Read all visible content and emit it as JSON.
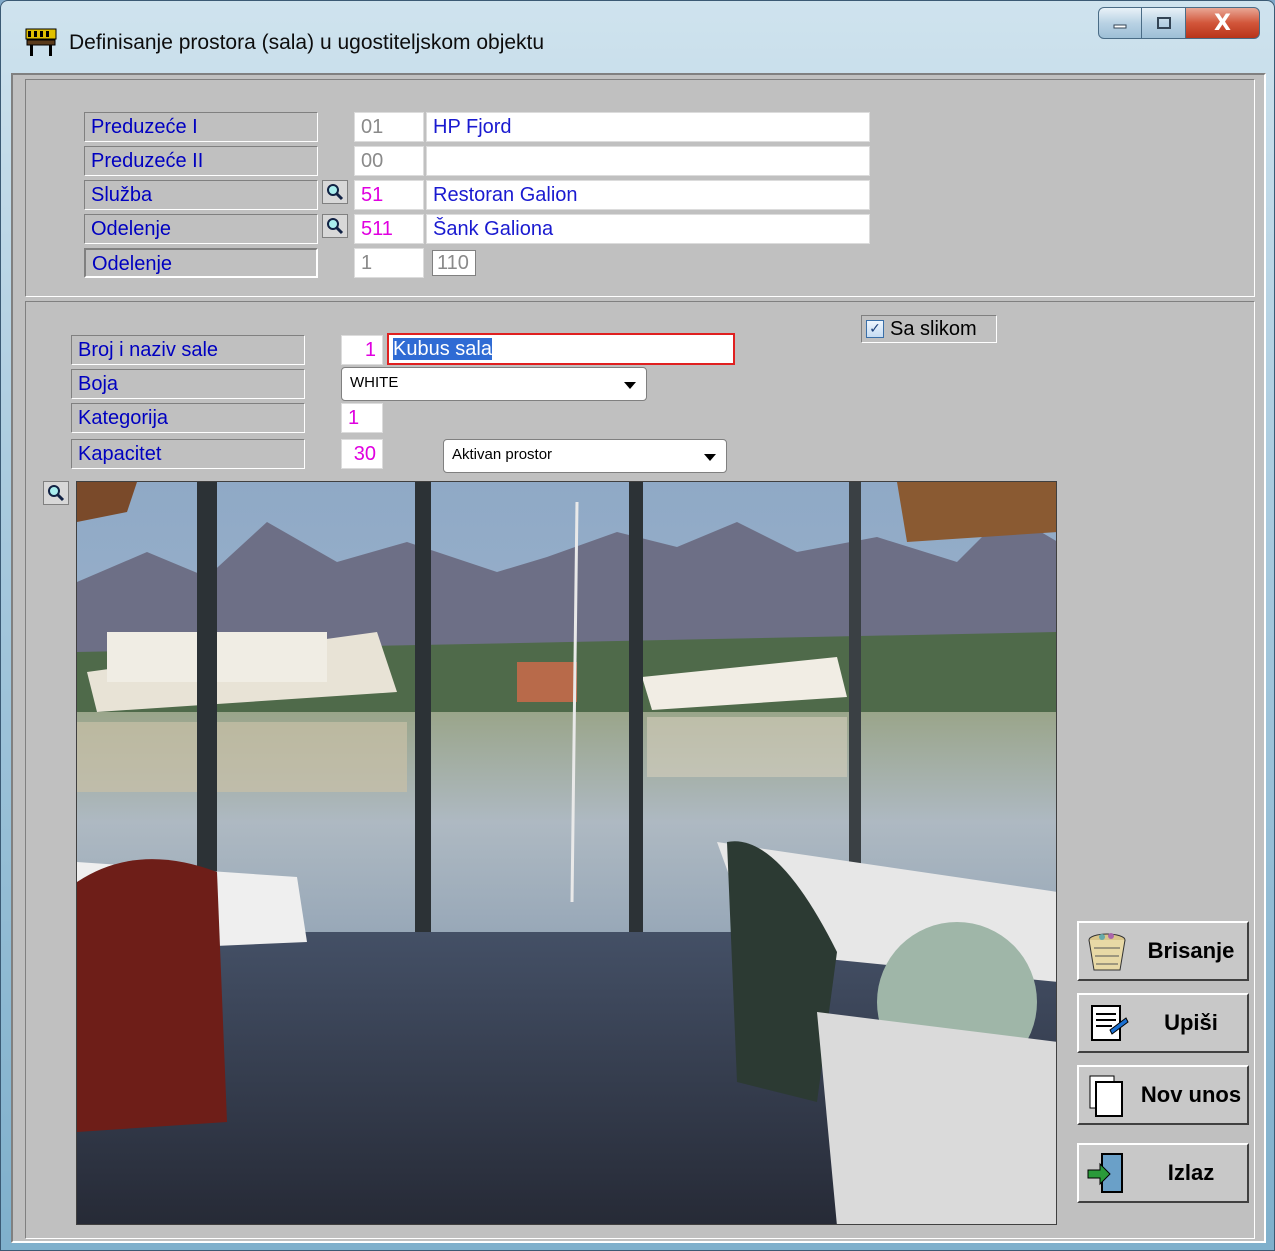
{
  "window": {
    "title": "Definisanje prostora (sala) u ugostiteljskom objektu",
    "close_glyph": "X"
  },
  "top_panel": {
    "rows": [
      {
        "label": "Preduzeće I",
        "code": "01",
        "name": "HP Fjord"
      },
      {
        "label": "Preduzeće II",
        "code": "00",
        "name": ""
      },
      {
        "label": "Služba",
        "code": "51",
        "name": "Restoran Galion"
      },
      {
        "label": "Odelenje",
        "code": "511",
        "name": "Šank Galiona"
      },
      {
        "label": "Odelenje",
        "code": "1",
        "extra": "110"
      }
    ]
  },
  "bottom_panel": {
    "sa_slikom": {
      "label": "Sa slikom",
      "checked": true,
      "check_glyph": "✓"
    },
    "broj_naziv": {
      "label": "Broj i naziv sale",
      "number": "1",
      "name": "Kubus sala"
    },
    "boja": {
      "label": "Boja",
      "value": "WHITE"
    },
    "kategorija": {
      "label": "Kategorija",
      "value": "1"
    },
    "kapacitet": {
      "label": "Kapacitet",
      "value": "30"
    },
    "status": {
      "value": "Aktivan prostor"
    }
  },
  "buttons": {
    "brisanje": "Brisanje",
    "upisi": "Upiši",
    "nov_unos": "Nov unos",
    "izlaz": "Izlaz"
  },
  "icons": [
    "app-icon",
    "magnifier-icon",
    "basket-icon",
    "scroll-write-icon",
    "new-pages-icon",
    "exit-door-icon"
  ]
}
